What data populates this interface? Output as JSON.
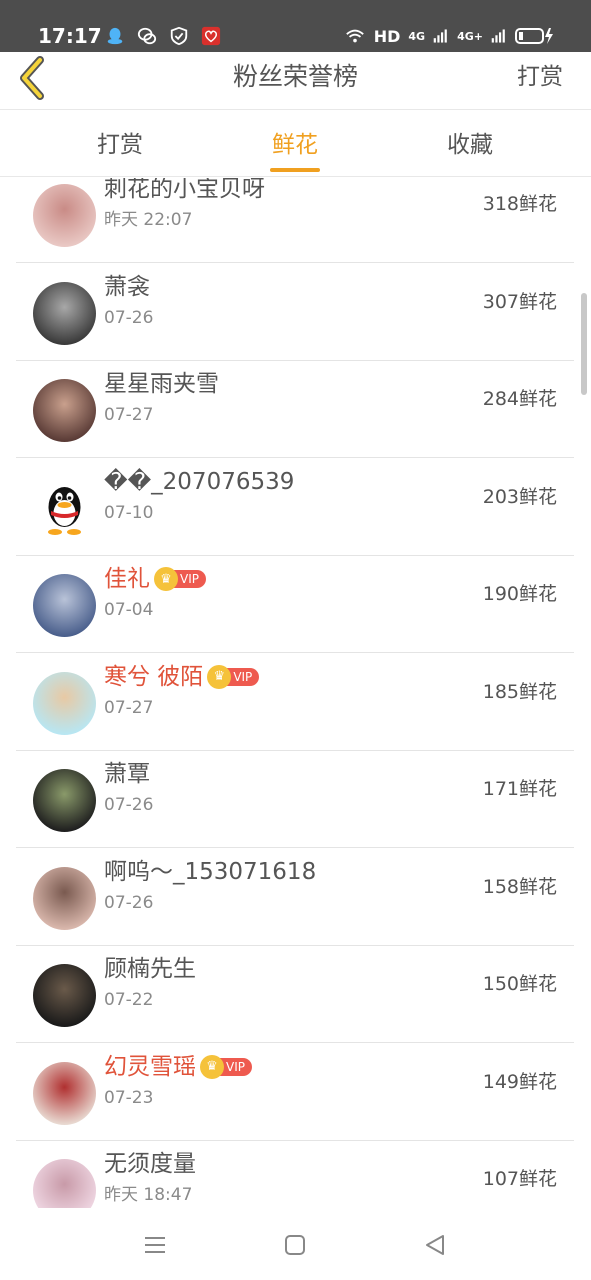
{
  "status_bar": {
    "time": "17:17",
    "network": "HD",
    "signal1": "4G",
    "signal2": "4G+"
  },
  "header": {
    "title": "粉丝荣誉榜",
    "action": "打赏"
  },
  "tabs": [
    {
      "label": "打赏",
      "active": false
    },
    {
      "label": "鲜花",
      "active": true
    },
    {
      "label": "收藏",
      "active": false
    }
  ],
  "vip_label": "VIP",
  "rows": [
    {
      "name": "刺花的小宝贝呀",
      "date": "昨天 22:07",
      "count": "318鲜花",
      "vip": false
    },
    {
      "name": "萧衾",
      "date": "07-26",
      "count": "307鲜花",
      "vip": false
    },
    {
      "name": "星星雨夹雪",
      "date": "07-27",
      "count": "284鲜花",
      "vip": false
    },
    {
      "name": "��_207076539",
      "date": "07-10",
      "count": "203鲜花",
      "vip": false
    },
    {
      "name": "佳礼",
      "date": "07-04",
      "count": "190鲜花",
      "vip": true
    },
    {
      "name": "寒兮 彼陌",
      "date": "07-27",
      "count": "185鲜花",
      "vip": true
    },
    {
      "name": "萧覃",
      "date": "07-26",
      "count": "171鲜花",
      "vip": false
    },
    {
      "name": "啊呜～_153071618",
      "date": "07-26",
      "count": "158鲜花",
      "vip": false
    },
    {
      "name": "顾楠先生",
      "date": "07-22",
      "count": "150鲜花",
      "vip": false
    },
    {
      "name": "幻灵雪瑶",
      "date": "07-23",
      "count": "149鲜花",
      "vip": true
    },
    {
      "name": "无须度量",
      "date": "昨天 18:47",
      "count": "107鲜花",
      "vip": false
    }
  ],
  "colors": {
    "accent": "#f0a020",
    "vip_name": "#e0533a",
    "vip_badge": "#ee5a4f",
    "status_bar": "#4d4d4d"
  }
}
